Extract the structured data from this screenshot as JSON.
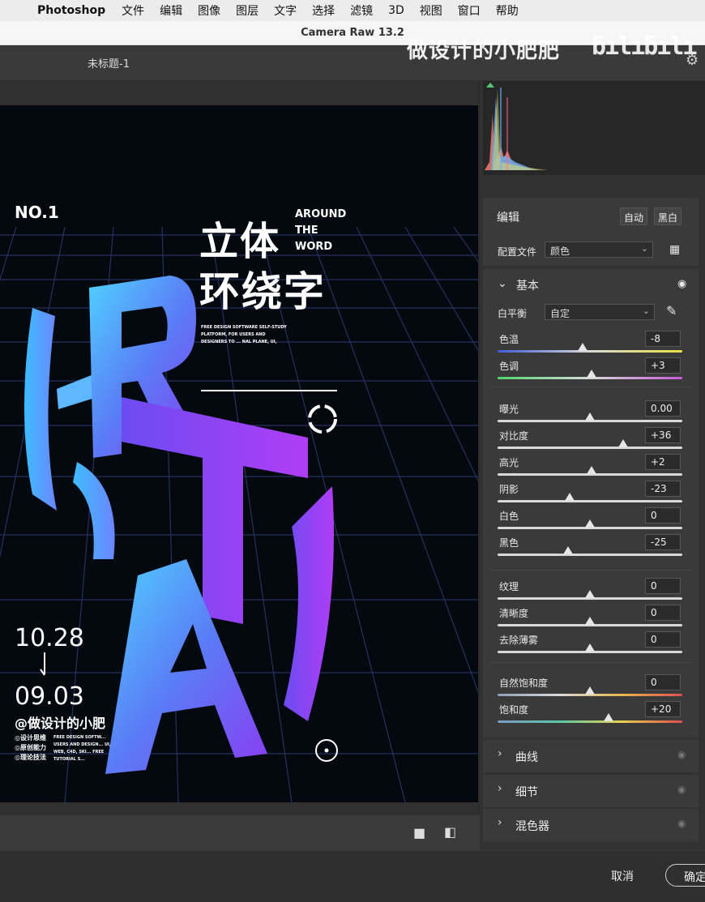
{
  "menubar": {
    "app_name": "Photoshop",
    "items": [
      "文件",
      "编辑",
      "图像",
      "图层",
      "文字",
      "选择",
      "滤镜",
      "3D",
      "视图",
      "窗口",
      "帮助"
    ]
  },
  "window": {
    "title": "Camera Raw 13.2",
    "doc_tab": "未标题-1"
  },
  "watermark": {
    "text": "做设计的小肥肥",
    "logo": "bilibili"
  },
  "poster": {
    "no": "NO.1",
    "title_line1": "立体",
    "title_line2": "环绕字",
    "around": "AROUND",
    "the": "THE",
    "word": "WORD",
    "small_text": "FREE DESIGN SOFTWARE SELF-STUDY PLATFORM, FOR USERS AND DESIGNERS TO ... NAL PLANE, UI,",
    "date1": "10.28",
    "date2": "09.03",
    "handle": "@做设计的小肥",
    "bullets": [
      "◎设计思维",
      "◎原创能力",
      "◎理论技法"
    ],
    "small_text2": "FREE DESIGN SOFTW... USERS AND DESIGN... UI, WEB, C4D, SKI... FREE TUTORIAL S...",
    "big_letters": [
      "R",
      "T",
      "A"
    ]
  },
  "panel": {
    "edit_title": "编辑",
    "auto_button": "自动",
    "bw_button": "黑白",
    "profile_label": "配置文件",
    "profile_value": "颜色",
    "basic_title": "基本",
    "wb_label": "白平衡",
    "wb_value": "自定",
    "sliders": [
      {
        "label": "色温",
        "value": "-8",
        "level": 0.46
      },
      {
        "label": "色调",
        "value": "+3",
        "level": 0.51
      },
      {
        "label": "曝光",
        "value": "0.00",
        "level": 0.5
      },
      {
        "label": "对比度",
        "value": "+36",
        "level": 0.68
      },
      {
        "label": "高光",
        "value": "+2",
        "level": 0.51
      },
      {
        "label": "阴影",
        "value": "-23",
        "level": 0.39
      },
      {
        "label": "白色",
        "value": "0",
        "level": 0.5
      },
      {
        "label": "黑色",
        "value": "-25",
        "level": 0.38
      },
      {
        "label": "纹理",
        "value": "0",
        "level": 0.5
      },
      {
        "label": "清晰度",
        "value": "0",
        "level": 0.5
      },
      {
        "label": "去除薄雾",
        "value": "0",
        "level": 0.5
      },
      {
        "label": "自然饱和度",
        "value": "0",
        "level": 0.5
      },
      {
        "label": "饱和度",
        "value": "+20",
        "level": 0.6
      }
    ],
    "collapsed_sections": [
      "曲线",
      "细节",
      "混色器"
    ]
  },
  "footer": {
    "cancel": "取消",
    "ok": "确定"
  }
}
